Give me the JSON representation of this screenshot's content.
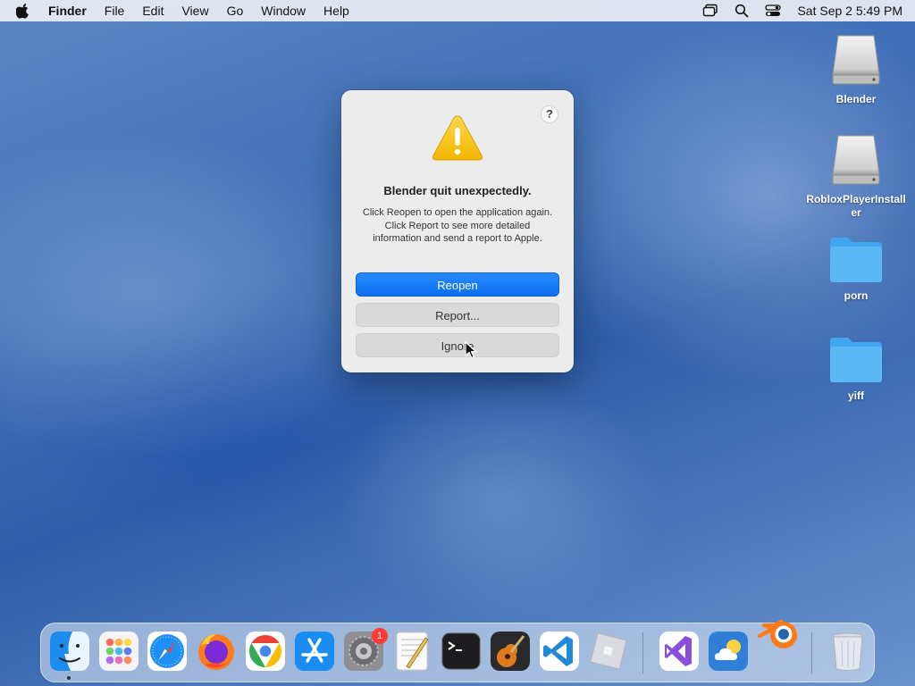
{
  "menubar": {
    "app_name": "Finder",
    "menus": [
      "File",
      "Edit",
      "View",
      "Go",
      "Window",
      "Help"
    ],
    "datetime": "Sat Sep 2  5:49 PM",
    "status_icons": [
      "screen-mirroring-icon",
      "spotlight-search-icon",
      "control-center-icon"
    ]
  },
  "desktop": {
    "icons": [
      {
        "label": "Blender",
        "kind": "drive"
      },
      {
        "label": "RobloxPlayerInstaller",
        "kind": "drive"
      },
      {
        "label": "porn",
        "kind": "folder"
      },
      {
        "label": "yiff",
        "kind": "folder"
      }
    ]
  },
  "dialog": {
    "help": "?",
    "title": "Blender quit unexpectedly.",
    "message": "Click Reopen to open the application again. Click Report to see more detailed information and send a report to Apple.",
    "buttons": {
      "reopen": "Reopen",
      "report": "Report...",
      "ignore": "Ignore"
    }
  },
  "dock": {
    "apps": [
      "Finder",
      "Launchpad",
      "Safari",
      "Firefox",
      "Google Chrome",
      "App Store",
      "System Settings",
      "TextEdit",
      "Terminal",
      "GarageBand",
      "Visual Studio Code",
      "Roblox",
      "Visual Studio",
      "Weather",
      "Blender",
      "Trash"
    ],
    "system_settings_badge": "1"
  },
  "colors": {
    "accent": "#0a6ef0",
    "badge": "#ff3b30",
    "folder": "#5ab8f5"
  }
}
